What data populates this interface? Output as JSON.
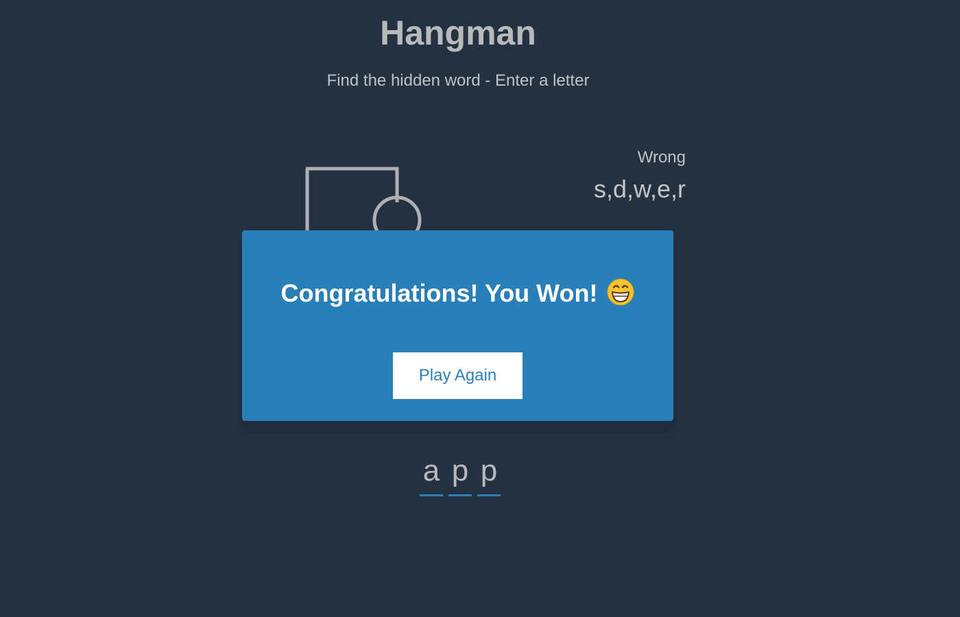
{
  "header": {
    "title": "Hangman",
    "subtitle": "Find the hidden word - Enter a letter"
  },
  "wrong": {
    "label": "Wrong",
    "letters": "s,d,w,e,r"
  },
  "popup": {
    "message": "Congratulations! You Won!",
    "emoji_icon": "grinning-face-icon",
    "button_label": "Play Again"
  },
  "word": {
    "letters": [
      "a",
      "p",
      "p"
    ]
  },
  "colors": {
    "background": "#233141",
    "popup": "#2980b9",
    "text": "#b6b8bb",
    "underline": "#2980b9"
  }
}
